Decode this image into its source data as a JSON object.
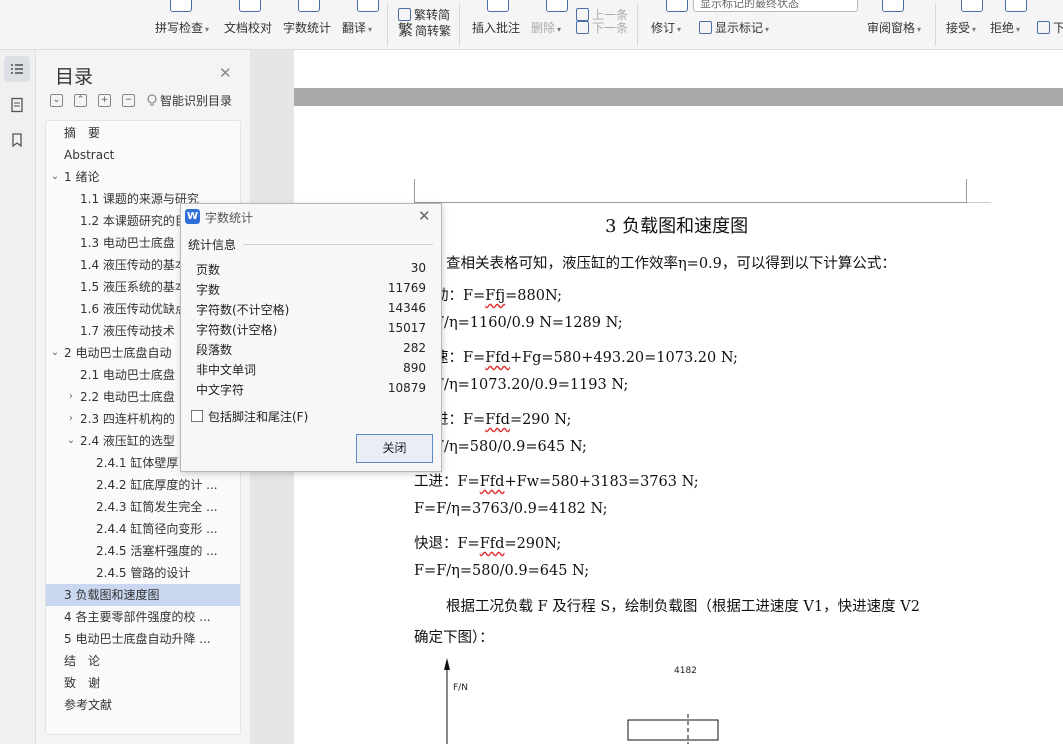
{
  "ribbon": {
    "buttons": [
      {
        "label": "拼写检查",
        "dropdown": true,
        "dim": false
      },
      {
        "label": "文档校对",
        "dropdown": false,
        "dim": false
      },
      {
        "label": "字数统计",
        "dropdown": false,
        "dim": false
      },
      {
        "label": "翻译",
        "dropdown": true,
        "dim": false
      },
      {
        "label": "繁转简",
        "dropdown": false,
        "dim": false
      },
      {
        "label": "简转繁",
        "dropdown": false,
        "dim": false
      },
      {
        "label": "插入批注",
        "dropdown": false,
        "dim": false
      },
      {
        "label": "删除",
        "dropdown": true,
        "dim": true
      },
      {
        "label": "上一条",
        "dropdown": false,
        "dim": true
      },
      {
        "label": "下一条",
        "dropdown": false,
        "dim": true
      },
      {
        "label": "修订",
        "dropdown": true,
        "dim": false
      },
      {
        "label": "显示标记的最终状态",
        "dropdown": true,
        "dim": false
      },
      {
        "label": "显示标记",
        "dropdown": true,
        "dim": false
      },
      {
        "label": "审阅窗格",
        "dropdown": true,
        "dim": false
      },
      {
        "label": "接受",
        "dropdown": true,
        "dim": false
      },
      {
        "label": "拒绝",
        "dropdown": true,
        "dim": false
      },
      {
        "label": "下一条",
        "dropdown": false,
        "dim": false
      }
    ]
  },
  "toc": {
    "title": "目录",
    "smart_label": "智能识别目录",
    "items": [
      {
        "label": "摘　要",
        "level": 0,
        "arrow": ""
      },
      {
        "label": "Abstract",
        "level": 0,
        "arrow": ""
      },
      {
        "label": "1  绪论",
        "level": 0,
        "arrow": "v"
      },
      {
        "label": "1.1  课题的来源与研究",
        "level": 1,
        "arrow": ""
      },
      {
        "label": "1.2  本课题研究的目的",
        "level": 1,
        "arrow": ""
      },
      {
        "label": "1.3  电动巴士底盘",
        "level": 1,
        "arrow": ""
      },
      {
        "label": "1.4  液压传动的基本",
        "level": 1,
        "arrow": ""
      },
      {
        "label": "1.5 液压系统的基本",
        "level": 1,
        "arrow": ""
      },
      {
        "label": "1.6 液压传动优缺点",
        "level": 1,
        "arrow": ""
      },
      {
        "label": "1.7 液压传动技术",
        "level": 1,
        "arrow": ""
      },
      {
        "label": "2  电动巴士底盘自动",
        "level": 0,
        "arrow": "v"
      },
      {
        "label": "2.1  电动巴士底盘",
        "level": 1,
        "arrow": ""
      },
      {
        "label": "2.2  电动巴士底盘",
        "level": 1,
        "arrow": ">"
      },
      {
        "label": "2.3  四连杆机构的",
        "level": 1,
        "arrow": ">"
      },
      {
        "label": "2.4 液压缸的选型",
        "level": 1,
        "arrow": "v"
      },
      {
        "label": "2.4.1 缸体壁厚",
        "level": 2,
        "arrow": ""
      },
      {
        "label": "2.4.2 缸底厚度的计 ...",
        "level": 2,
        "arrow": ""
      },
      {
        "label": "2.4.3 缸筒发生完全 ...",
        "level": 2,
        "arrow": ""
      },
      {
        "label": "2.4.4 缸筒径向变形 ...",
        "level": 2,
        "arrow": ""
      },
      {
        "label": "2.4.5 活塞杆强度的 ...",
        "level": 2,
        "arrow": ""
      },
      {
        "label": "2.4.5  管路的设计",
        "level": 2,
        "arrow": ""
      },
      {
        "label": "3  负载图和速度图",
        "level": 0,
        "arrow": "",
        "selected": true
      },
      {
        "label": "4  各主要零部件强度的校 ...",
        "level": 0,
        "arrow": ""
      },
      {
        "label": "5  电动巴士底盘自动升降 ...",
        "level": 0,
        "arrow": ""
      },
      {
        "label": "结　论",
        "level": 0,
        "arrow": ""
      },
      {
        "label": "致　谢",
        "level": 0,
        "arrow": ""
      },
      {
        "label": "参考文献",
        "level": 0,
        "arrow": ""
      }
    ]
  },
  "dialog": {
    "title": "字数统计",
    "group_label": "统计信息",
    "stats": [
      {
        "label": "页数",
        "value": "30"
      },
      {
        "label": "字数",
        "value": "11769"
      },
      {
        "label": "字符数(不计空格)",
        "value": "14346"
      },
      {
        "label": "字符数(计空格)",
        "value": "15017"
      },
      {
        "label": "段落数",
        "value": "282"
      },
      {
        "label": "非中文单词",
        "value": "890"
      },
      {
        "label": "中文字符",
        "value": "10879"
      }
    ],
    "checkbox_label": "包括脚注和尾注(F)",
    "checkbox_checked": false,
    "close_button": "关闭"
  },
  "document": {
    "heading": "3  负载图和速度图",
    "intro_line": "查相关表格可知，液压缸的工作效率η=0.9，可以得到以下计算公式：",
    "lines": [
      {
        "pre": "动：F=",
        "wavy": "Ffj",
        "post": "=880N;"
      },
      {
        "pre": "F/η=1160/0.9 N=1289 N;",
        "wavy": "",
        "post": ""
      },
      {
        "pre": "速：F=",
        "wavy": "Ffd",
        "post": "+Fg=580+493.20=1073.20 N;"
      },
      {
        "pre": "F/η=1073.20/0.9=1193 N;",
        "wavy": "",
        "post": ""
      },
      {
        "pre": "进：F=",
        "wavy": "Ffd",
        "post": "=290 N;"
      },
      {
        "pre": "F/η=580/0.9=645 N;",
        "wavy": "",
        "post": ""
      },
      {
        "pre": "工进：F=",
        "wavy": "Ffd",
        "post": "+Fw=580+3183=3763 N;"
      },
      {
        "pre": "F=F/η=3763/0.9=4182 N;",
        "wavy": "",
        "post": ""
      },
      {
        "pre": "快退：F=",
        "wavy": "Ffd",
        "post": "=290N;"
      },
      {
        "pre": "F=F/η=580/0.9=645 N;",
        "wavy": "",
        "post": ""
      }
    ],
    "para_line1": "根据工况负载 F 及行程 S，绘制负载图（根据工进速度 V1，快进速度 V2",
    "para_line2": "确定下图）：",
    "chart_axis_label": "F/N",
    "chart_value_label": "4182"
  }
}
